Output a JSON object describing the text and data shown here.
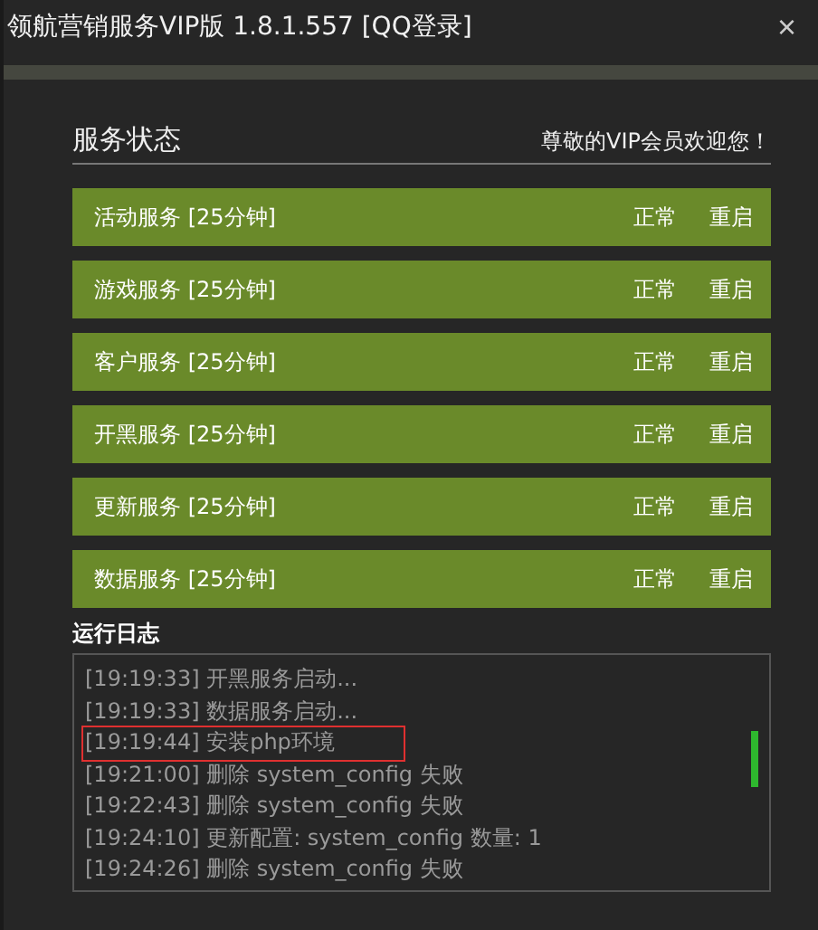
{
  "window": {
    "title": "领航营销服务VIP版 1.8.1.557 [QQ登录]",
    "close": "×"
  },
  "status": {
    "title": "服务状态",
    "welcome": "尊敬的VIP会员欢迎您！"
  },
  "services": [
    {
      "name": "活动服务 [25分钟]",
      "state": "正常",
      "action": "重启"
    },
    {
      "name": "游戏服务 [25分钟]",
      "state": "正常",
      "action": "重启"
    },
    {
      "name": "客户服务 [25分钟]",
      "state": "正常",
      "action": "重启"
    },
    {
      "name": "开黑服务 [25分钟]",
      "state": "正常",
      "action": "重启"
    },
    {
      "name": "更新服务 [25分钟]",
      "state": "正常",
      "action": "重启"
    },
    {
      "name": "数据服务 [25分钟]",
      "state": "正常",
      "action": "重启"
    }
  ],
  "log": {
    "title": "运行日志",
    "lines": [
      {
        "text": "[19:19:33] 开黑服务启动...",
        "highlighted": false
      },
      {
        "text": "[19:19:33] 数据服务启动...",
        "highlighted": false
      },
      {
        "text": "[19:19:44] 安装php环境",
        "highlighted": true
      },
      {
        "text": "[19:21:00] 删除 system_config 失败",
        "highlighted": false
      },
      {
        "text": "[19:22:43] 删除 system_config 失败",
        "highlighted": false
      },
      {
        "text": "[19:24:10] 更新配置: system_config 数量: 1",
        "highlighted": false
      },
      {
        "text": "[19:24:26] 删除 system_config 失败",
        "highlighted": false
      }
    ]
  }
}
